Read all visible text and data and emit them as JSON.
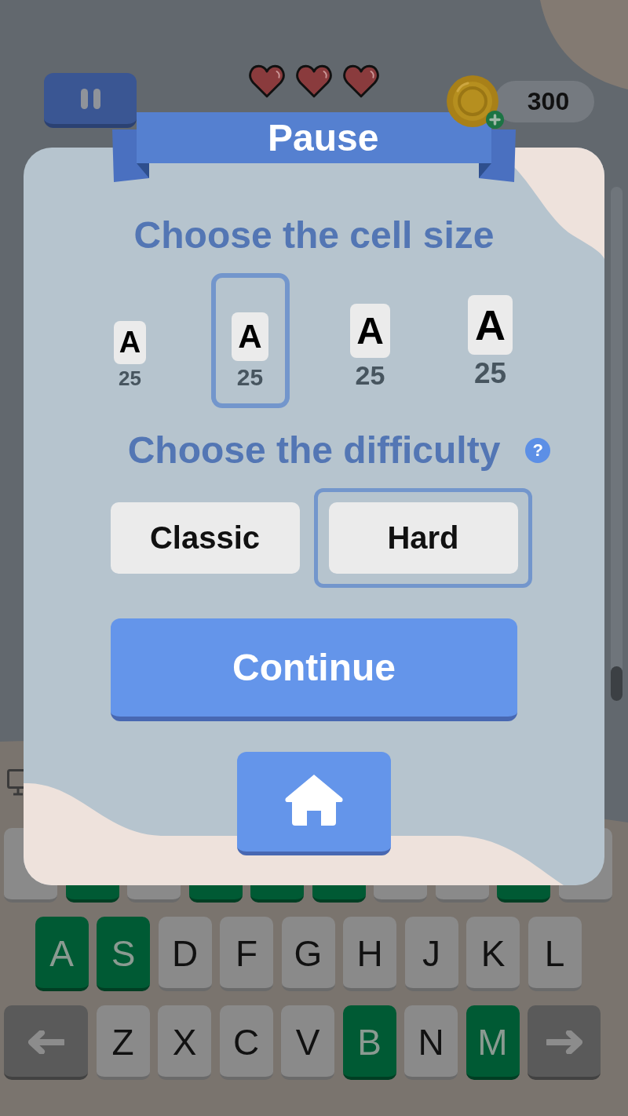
{
  "top_bar": {
    "hearts": [
      {
        "filled": true
      },
      {
        "filled": true
      },
      {
        "filled": true
      }
    ],
    "coins": "300"
  },
  "dialog": {
    "title": "Pause",
    "cell_size": {
      "heading": "Choose the cell size",
      "options": [
        {
          "letter": "A",
          "count": "25",
          "selected": false
        },
        {
          "letter": "A",
          "count": "25",
          "selected": true
        },
        {
          "letter": "A",
          "count": "25",
          "selected": false
        },
        {
          "letter": "A",
          "count": "25",
          "selected": false
        }
      ]
    },
    "difficulty": {
      "heading": "Choose the difficulty",
      "help": "?",
      "options": [
        {
          "label": "Classic",
          "selected": false
        },
        {
          "label": "Hard",
          "selected": true
        }
      ]
    },
    "continue_button": "Continue"
  },
  "keyboard": {
    "rows": [
      [
        {
          "kind": "letter",
          "correct": false
        },
        {
          "kind": "letter",
          "correct": true
        },
        {
          "kind": "letter",
          "correct": false
        },
        {
          "kind": "letter",
          "correct": true
        },
        {
          "kind": "letter",
          "correct": true
        },
        {
          "kind": "letter",
          "correct": true
        },
        {
          "kind": "letter",
          "correct": false
        },
        {
          "kind": "letter",
          "correct": false
        },
        {
          "kind": "letter",
          "correct": true
        },
        {
          "kind": "letter",
          "correct": false
        }
      ],
      [
        {
          "kind": "letter",
          "label": "A",
          "correct": true
        },
        {
          "kind": "letter",
          "label": "S",
          "correct": true
        },
        {
          "kind": "letter",
          "label": "D",
          "correct": false
        },
        {
          "kind": "letter",
          "label": "F",
          "correct": false
        },
        {
          "kind": "letter",
          "label": "G",
          "correct": false
        },
        {
          "kind": "letter",
          "label": "H",
          "correct": false
        },
        {
          "kind": "letter",
          "label": "J",
          "correct": false
        },
        {
          "kind": "letter",
          "label": "K",
          "correct": false
        },
        {
          "kind": "letter",
          "label": "L",
          "correct": false
        }
      ],
      [
        {
          "kind": "back"
        },
        {
          "kind": "letter",
          "label": "Z",
          "correct": false
        },
        {
          "kind": "letter",
          "label": "X",
          "correct": false
        },
        {
          "kind": "letter",
          "label": "C",
          "correct": false
        },
        {
          "kind": "letter",
          "label": "V",
          "correct": false
        },
        {
          "kind": "letter",
          "label": "B",
          "correct": true
        },
        {
          "kind": "letter",
          "label": "N",
          "correct": false
        },
        {
          "kind": "letter",
          "label": "M",
          "correct": true
        },
        {
          "kind": "forward"
        }
      ]
    ]
  }
}
